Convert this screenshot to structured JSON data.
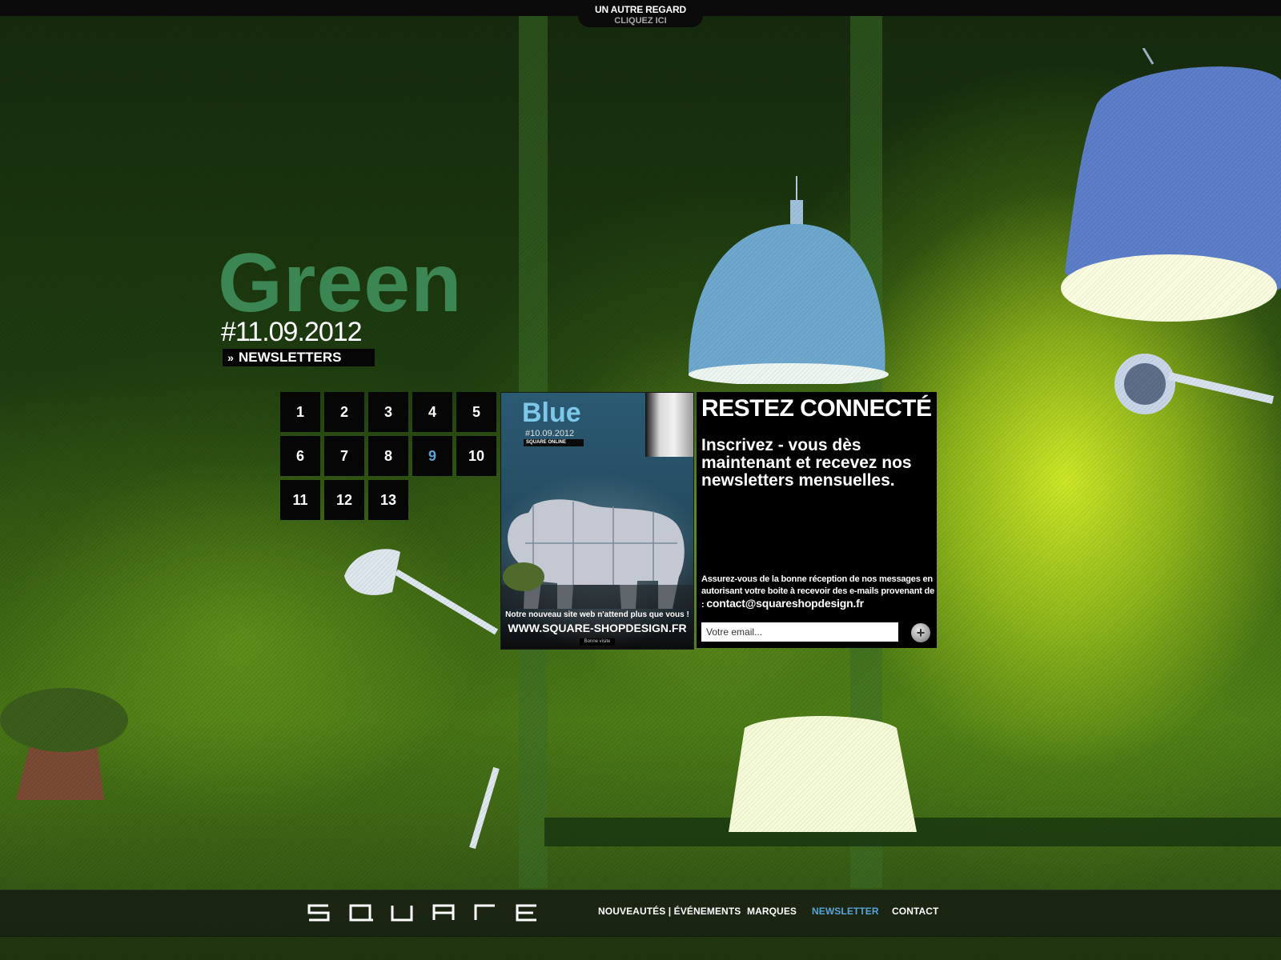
{
  "top_tab": {
    "line1": "UN AUTRE REGARD",
    "line2": "CLIQUEZ ICI"
  },
  "hero": {
    "title": "Green",
    "date": "#11.09.2012",
    "link_label": "NEWSLETTERS",
    "title_color": "#3f8f5a"
  },
  "issues": {
    "numbers": [
      "1",
      "2",
      "3",
      "4",
      "5",
      "6",
      "7",
      "8",
      "9",
      "10",
      "11",
      "12",
      "13"
    ],
    "active": "9",
    "active_color": "#5aa3d8"
  },
  "promo": {
    "title": "Blue",
    "date": "#10.09.2012",
    "online_label": "SQUARE ONLINE",
    "caption": "Notre nouveau site web n'attend plus que vous !",
    "url": "WWW.SQUARE-SHOPDESIGN.FR",
    "visit": "Bonne visite"
  },
  "newsletter": {
    "title": "RESTEZ CONNECTÉ",
    "subtitle": "Inscrivez - vous dès maintenant et recevez nos newsletters mensuelles.",
    "note": "Assurez-vous de la bonne réception de nos messages en autorisant votre boite à recevoir des e-mails provenant de : ",
    "email": "contact@squareshopdesign.fr",
    "input_placeholder": "Votre email...",
    "submit_icon": "plus-icon"
  },
  "footer": {
    "logo": "SQUARE",
    "nav": [
      {
        "label": "NOUVEAUTÉS | ÉVÉNEMENTS",
        "active": false
      },
      {
        "label": "MARQUES",
        "active": false
      },
      {
        "label": "NEWSLETTER",
        "active": true
      },
      {
        "label": "CONTACT",
        "active": false
      }
    ]
  }
}
